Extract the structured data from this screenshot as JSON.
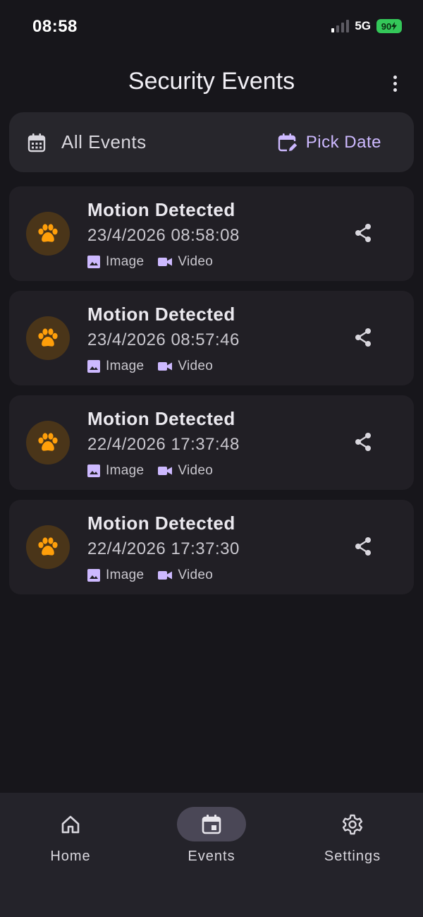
{
  "status_bar": {
    "time": "08:58",
    "network": "5G",
    "battery": "90"
  },
  "header": {
    "title": "Security Events",
    "more_icon": "more-vert-icon"
  },
  "filter": {
    "label": "All Events",
    "pick_date_label": "Pick Date",
    "calendar_icon": "calendar-icon",
    "edit_calendar_icon": "edit-calendar-icon"
  },
  "events": [
    {
      "title": "Motion Detected",
      "timestamp": "23/4/2026 08:58:08",
      "image_label": "Image",
      "video_label": "Video"
    },
    {
      "title": "Motion Detected",
      "timestamp": "23/4/2026 08:57:46",
      "image_label": "Image",
      "video_label": "Video"
    },
    {
      "title": "Motion Detected",
      "timestamp": "22/4/2026 17:37:48",
      "image_label": "Image",
      "video_label": "Video"
    },
    {
      "title": "Motion Detected",
      "timestamp": "22/4/2026 17:37:30",
      "image_label": "Image",
      "video_label": "Video"
    }
  ],
  "nav": {
    "items": [
      {
        "label": "Home",
        "icon": "home-icon",
        "active": false
      },
      {
        "label": "Events",
        "icon": "event-icon",
        "active": true
      },
      {
        "label": "Settings",
        "icon": "gear-icon",
        "active": false
      }
    ]
  },
  "colors": {
    "background": "#17161b",
    "accent": "#cdb9ff",
    "paw": "#ff9f0a",
    "battery": "#34c759"
  }
}
